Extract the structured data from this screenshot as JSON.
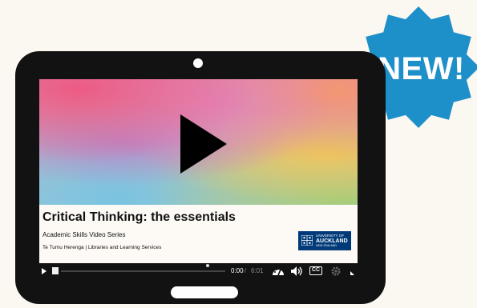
{
  "video": {
    "title": "Critical Thinking: the essentials",
    "series": "Academic Skills Video Series",
    "credit": "Te Tumu Herenga | Libraries and Learning Services",
    "progress_fraction": 0.0
  },
  "logo": {
    "line1": "UNIVERSITY OF",
    "line2": "AUCKLAND",
    "line3": "NEW ZEALAND"
  },
  "controls": {
    "time_current": "0:00",
    "time_separator": "/",
    "time_total": "6:01",
    "cc_label": "CC"
  },
  "badge": {
    "label": "NEW!",
    "color": "#1d8fc9"
  },
  "icons": [
    "play-icon",
    "speed-icon",
    "volume-icon",
    "closed-captions-icon",
    "settings-icon",
    "fullscreen-icon",
    "university-crest-icon"
  ]
}
